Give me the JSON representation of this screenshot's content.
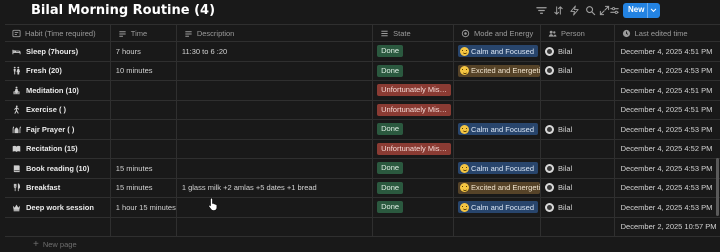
{
  "page": {
    "title": "Bilal Morning Routine (4)"
  },
  "toolbar": {
    "icons": [
      "filter-icon",
      "sort-icon",
      "lightning-icon",
      "search-icon",
      "expand-icon",
      "more-icon"
    ],
    "new_label": "New"
  },
  "columns": {
    "habit": "Habit (Time required)",
    "time": "Time",
    "description": "Description",
    "state": "State",
    "mode": "Mode and Energy",
    "person": "Person",
    "edited": "Last edited time"
  },
  "rows": [
    {
      "name": "Sleep (7hours)",
      "icon": "bed-icon",
      "time": "7 hours",
      "description": "11:30  to 6 :20",
      "state": "Done",
      "mode": "Calm and Focused",
      "person": "Bilal",
      "edited": "December 4, 2025 4:51 PM"
    },
    {
      "name": "Fresh (20)",
      "icon": "restroom-icon",
      "time": "10 minutes",
      "description": "",
      "state": "Done",
      "mode": "Excited and Energetic",
      "person": "Bilal",
      "edited": "December 4, 2025 4:53 PM"
    },
    {
      "name": "Meditation (10)",
      "icon": "meditation-icon",
      "time": "",
      "description": "",
      "state": "Unfortunately Missed",
      "mode": "",
      "person": "",
      "edited": "December 4, 2025 4:51 PM"
    },
    {
      "name": "Exercise ( )",
      "icon": "exercise-icon",
      "time": "",
      "description": "",
      "state": "Unfortunately Missed",
      "mode": "",
      "person": "",
      "edited": "December 4, 2025 4:51 PM"
    },
    {
      "name": "Fajr Prayer ( )",
      "icon": "mosque-icon",
      "time": "",
      "description": "",
      "state": "Done",
      "mode": "Calm and Focused",
      "person": "Bilal",
      "edited": "December 4, 2025 4:53 PM"
    },
    {
      "name": "Recitation (15)",
      "icon": "quran-icon",
      "time": "",
      "description": "",
      "state": "Unfortunately Missed",
      "mode": "",
      "person": "",
      "edited": "December 4, 2025 4:52 PM"
    },
    {
      "name": "Book reading  (10)",
      "icon": "book-icon",
      "time": "15 minutes",
      "description": "",
      "state": "Done",
      "mode": "Calm and Focused",
      "person": "Bilal",
      "edited": "December 4, 2025 4:53 PM"
    },
    {
      "name": "Breakfast",
      "icon": "utensils-icon",
      "time": "15 minutes",
      "description": "1 glass milk +2 amlas +5 dates +1 bread",
      "state": "Done",
      "mode": "Excited and Energetic",
      "person": "Bilal",
      "edited": "December 4, 2025 4:53 PM"
    },
    {
      "name": "Deep work session",
      "icon": "crown-icon",
      "time": "1 hour 15 minutes",
      "description": "",
      "state": "Done",
      "mode": "Calm and Focused",
      "person": "Bilal",
      "edited": "December 4, 2025 4:53 PM"
    },
    {
      "name": "",
      "icon": "",
      "time": "",
      "description": "",
      "state": "",
      "mode": "",
      "person": "",
      "edited": "December 2, 2025 10:57 PM"
    }
  ],
  "footer": {
    "new_page": "New page"
  },
  "colors": {
    "background": "#191919",
    "accent": "#2383e2",
    "done": "#2b593f",
    "missed": "#8a3b33",
    "calm": "#28456c",
    "excited": "#564328"
  }
}
